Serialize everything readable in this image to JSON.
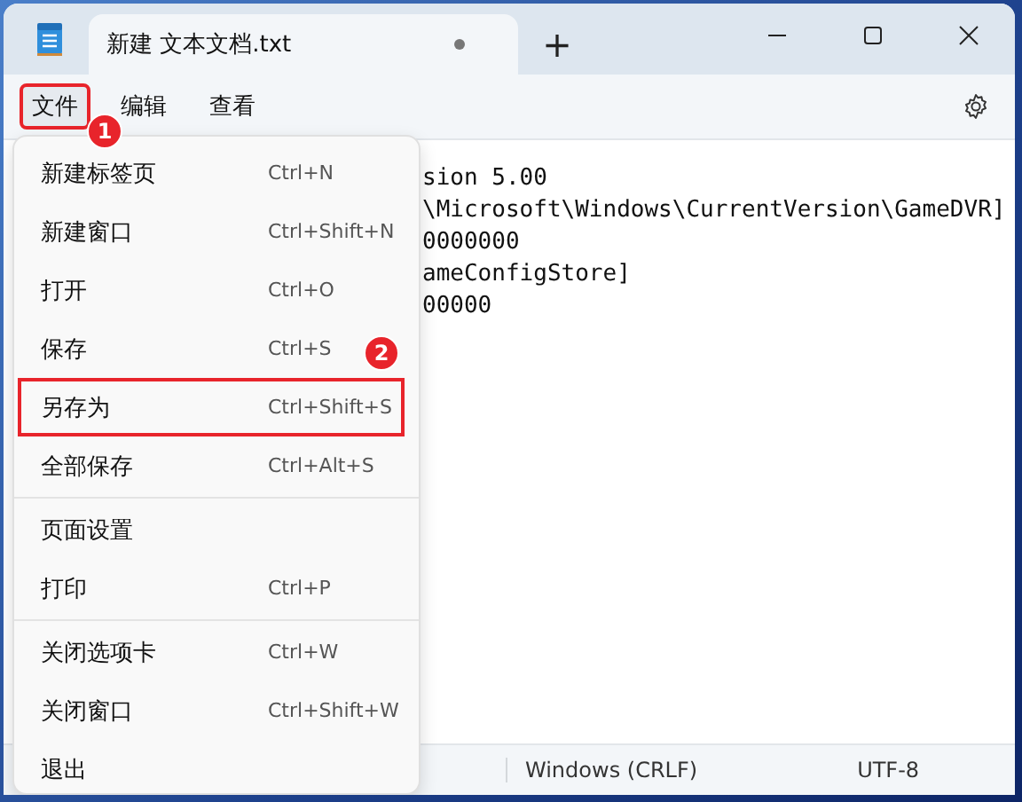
{
  "window": {
    "tab_title": "新建 文本文档.txt",
    "modified": true,
    "new_tab": "+"
  },
  "menu_bar": [
    {
      "label": "文件",
      "selected": true,
      "annotated": true,
      "badge": "1"
    },
    {
      "label": "编辑",
      "selected": false,
      "annotated": false
    },
    {
      "label": "查看",
      "selected": false,
      "annotated": false
    }
  ],
  "editor_lines": [
    "sion 5.00",
    "\\Microsoft\\Windows\\CurrentVersion\\GameDVR]",
    "0000000",
    "ameConfigStore]",
    "00000"
  ],
  "file_menu": [
    {
      "kind": "item",
      "label": "新建标签页",
      "shortcut": "Ctrl+N",
      "annotated": false
    },
    {
      "kind": "item",
      "label": "新建窗口",
      "shortcut": "Ctrl+Shift+N",
      "annotated": false
    },
    {
      "kind": "item",
      "label": "打开",
      "shortcut": "Ctrl+O",
      "annotated": false
    },
    {
      "kind": "item",
      "label": "保存",
      "shortcut": "Ctrl+S",
      "annotated": false,
      "badge": "2"
    },
    {
      "kind": "item",
      "label": "另存为",
      "shortcut": "Ctrl+Shift+S",
      "annotated": true
    },
    {
      "kind": "item",
      "label": "全部保存",
      "shortcut": "Ctrl+Alt+S",
      "annotated": false
    },
    {
      "kind": "separator"
    },
    {
      "kind": "item",
      "label": "页面设置",
      "annotated": false
    },
    {
      "kind": "item",
      "label": "打印",
      "shortcut": "Ctrl+P",
      "annotated": false
    },
    {
      "kind": "separator"
    },
    {
      "kind": "item",
      "label": "关闭选项卡",
      "shortcut": "Ctrl+W",
      "annotated": false
    },
    {
      "kind": "item",
      "label": "关闭窗口",
      "shortcut": "Ctrl+Shift+W",
      "annotated": false
    },
    {
      "kind": "item",
      "label": "退出",
      "annotated": false
    }
  ],
  "status_bar": [
    "Windows (CRLF)",
    "UTF-8"
  ]
}
